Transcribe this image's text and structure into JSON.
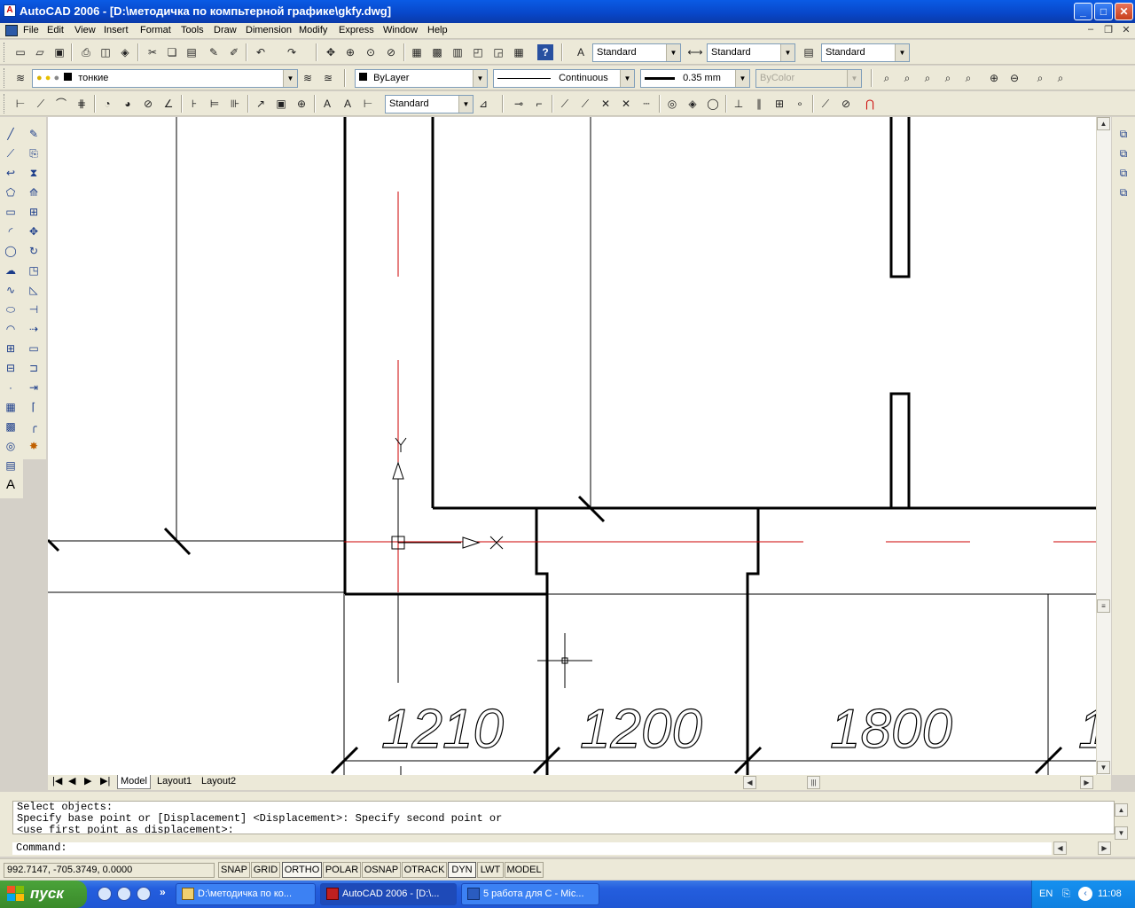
{
  "window": {
    "title": "AutoCAD 2006 - [D:\\методичка по компьтерной графике\\gkfy.dwg]",
    "minimize": "_",
    "maximize": "□",
    "close": "✕"
  },
  "menu": {
    "items": [
      "File",
      "Edit",
      "View",
      "Insert",
      "Format",
      "Tools",
      "Draw",
      "Dimension",
      "Modify",
      "Express",
      "Window",
      "Help"
    ],
    "doc_controls": [
      "–",
      "❐",
      "✕"
    ]
  },
  "styles_toolbar": {
    "text_style": "Standard",
    "dim_style": "Standard",
    "table_style": "Standard"
  },
  "layers_toolbar": {
    "current_layer": "тонкие"
  },
  "properties_toolbar": {
    "color": "ByLayer",
    "linetype": "Continuous",
    "lineweight": "0.35 mm",
    "plotstyle": "ByColor"
  },
  "dimension_toolbar": {
    "dim_style": "Standard"
  },
  "drawing": {
    "dim_labels": [
      "1210",
      "1200",
      "1800",
      "1"
    ],
    "ucs_x": "X",
    "ucs_y": "Y"
  },
  "layout_tabs": [
    "Model",
    "Layout1",
    "Layout2"
  ],
  "command": {
    "history": "Select objects:\nSpecify base point or [Displacement] <Displacement>: Specify second point or\n<use first point as displacement>:",
    "prompt": "Command:"
  },
  "status": {
    "coordinates": "992.7147,  -705.3749, 0.0000",
    "toggles": [
      "SNAP",
      "GRID",
      "ORTHO",
      "POLAR",
      "OSNAP",
      "OTRACK",
      "DYN",
      "LWT",
      "MODEL"
    ]
  },
  "taskbar": {
    "start_label": "пуск",
    "tasks": [
      "D:\\методичка по ко...",
      "AutoCAD 2006 - [D:\\...",
      "5 работа для С - Mic..."
    ],
    "language": "EN",
    "clock": "11:08"
  },
  "colors": {
    "titlebar": "#0a5be5",
    "centerline": "#cc0000",
    "canvas": "#ffffff",
    "toolbar_bg": "#ece9d8"
  }
}
